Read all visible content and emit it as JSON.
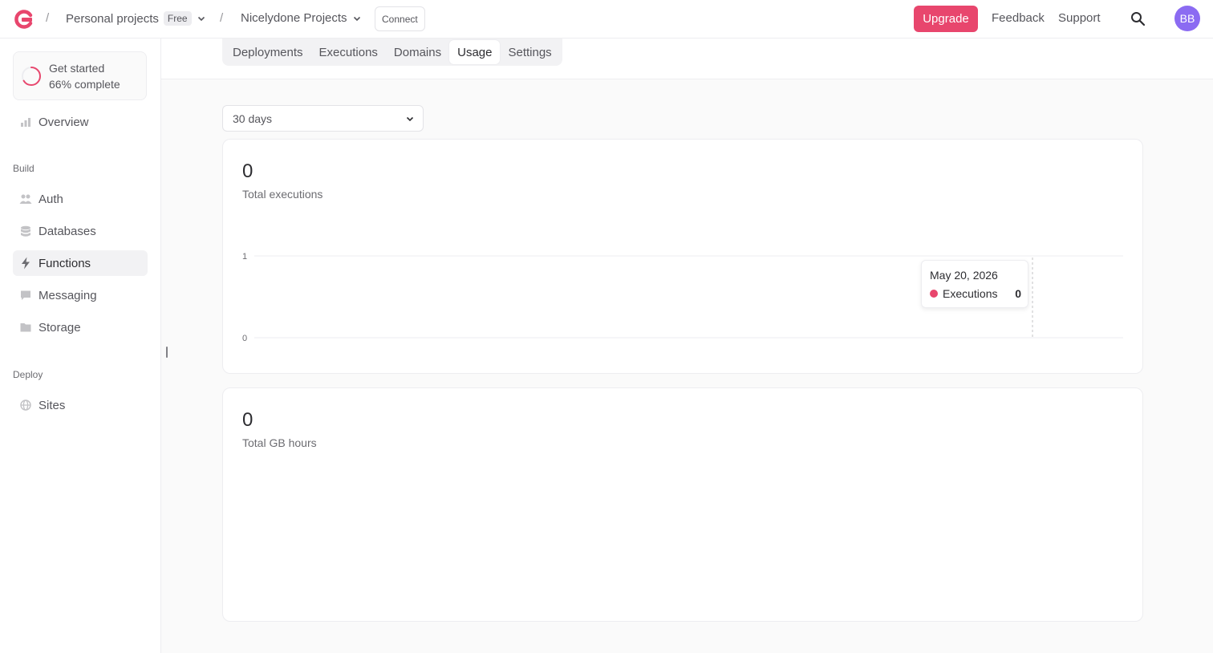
{
  "header": {
    "org_name": "Personal projects",
    "org_plan": "Free",
    "project_name": "Nicelydone Projects",
    "connect_label": "Connect",
    "upgrade_label": "Upgrade",
    "feedback_label": "Feedback",
    "support_label": "Support",
    "avatar_initials": "BB",
    "separator": "/"
  },
  "sidebar": {
    "get_started": {
      "title": "Get started",
      "progress": "66% complete",
      "progress_value": 0.66
    },
    "overview_label": "Overview",
    "build_label": "Build",
    "build_items": [
      {
        "label": "Auth",
        "icon": "users-icon"
      },
      {
        "label": "Databases",
        "icon": "database-icon"
      },
      {
        "label": "Functions",
        "icon": "lightning-icon",
        "active": true
      },
      {
        "label": "Messaging",
        "icon": "chat-icon"
      },
      {
        "label": "Storage",
        "icon": "folder-icon"
      }
    ],
    "deploy_label": "Deploy",
    "deploy_items": [
      {
        "label": "Sites",
        "icon": "globe-icon"
      }
    ]
  },
  "tabs": [
    {
      "label": "Deployments"
    },
    {
      "label": "Executions"
    },
    {
      "label": "Domains"
    },
    {
      "label": "Usage",
      "active": true
    },
    {
      "label": "Settings"
    }
  ],
  "range": {
    "selected": "30 days"
  },
  "executions_card": {
    "value": "0",
    "label": "Total executions",
    "tooltip": {
      "date": "May 20, 2026",
      "series": "Executions",
      "value": "0"
    }
  },
  "gb_hours_card": {
    "value": "0",
    "label": "Total GB hours"
  },
  "colors": {
    "accent": "#e8466d",
    "avatar": "#8b6bf2"
  },
  "chart_data": {
    "type": "line",
    "title": "",
    "xlabel": "",
    "ylabel": "",
    "ylim": [
      0,
      1
    ],
    "yticks": [
      "1",
      "0"
    ],
    "series": [
      {
        "name": "Executions",
        "x": [
          "May 20, 2026"
        ],
        "values": [
          0
        ]
      }
    ],
    "grid": true
  }
}
